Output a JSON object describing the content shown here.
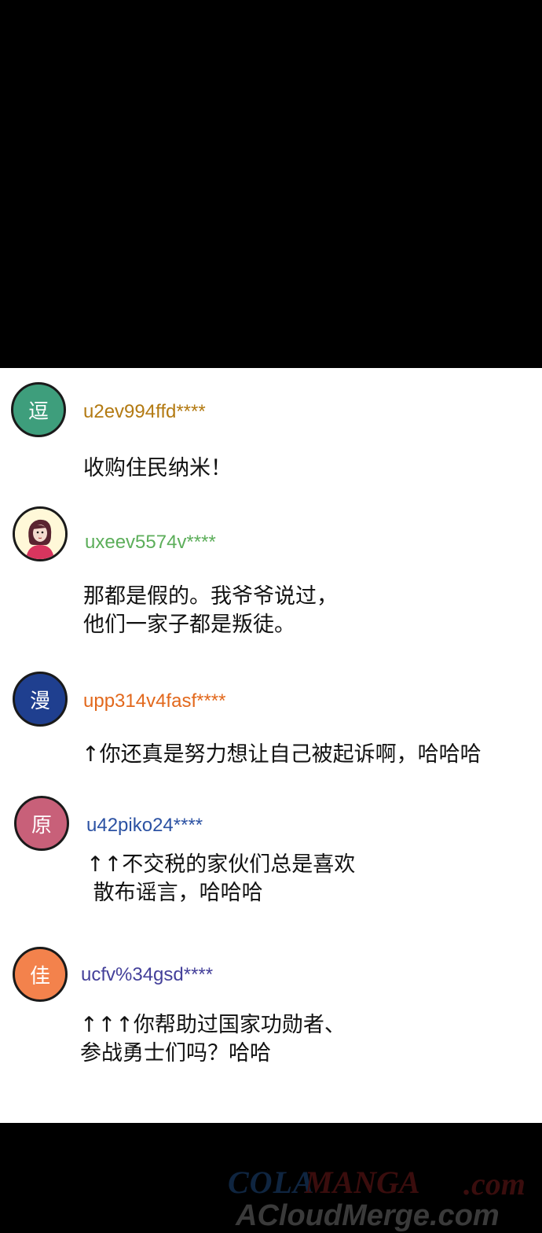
{
  "comments": [
    {
      "avatar_char": "逗",
      "avatar_color": "#3e9e7c",
      "username": "u2ev994ffd****",
      "username_color": "#b37a12",
      "text": "收购住民纳米！"
    },
    {
      "avatar_char": "",
      "avatar_type": "portrait",
      "username": "uxeev5574v****",
      "username_color": "#5cae5a",
      "text": "那都是假的。我爷爷说过，\n他们一家子都是叛徒。"
    },
    {
      "avatar_char": "漫",
      "avatar_color": "#1f3f8f",
      "username": "upp314v4fasf****",
      "username_color": "#e2681c",
      "text": "↑你还真是努力想让自己被起诉啊，哈哈哈"
    },
    {
      "avatar_char": "原",
      "avatar_color": "#c86079",
      "username": "u42piko24****",
      "username_color": "#2c52a3",
      "text": "↑↑不交税的家伙们总是喜欢\n 散布谣言，哈哈哈"
    },
    {
      "avatar_char": "佳",
      "avatar_color": "#f3824c",
      "username": "ucfv%34gsd****",
      "username_color": "#44409a",
      "text": "↑↑↑你帮助过国家功勋者、\n参战勇士们吗？哈哈"
    }
  ],
  "watermark": {
    "line1_part1": "COLA",
    "line1_part2": "MANGA",
    "line1_part3": ".com",
    "line2": "ACloudMerge.com"
  }
}
